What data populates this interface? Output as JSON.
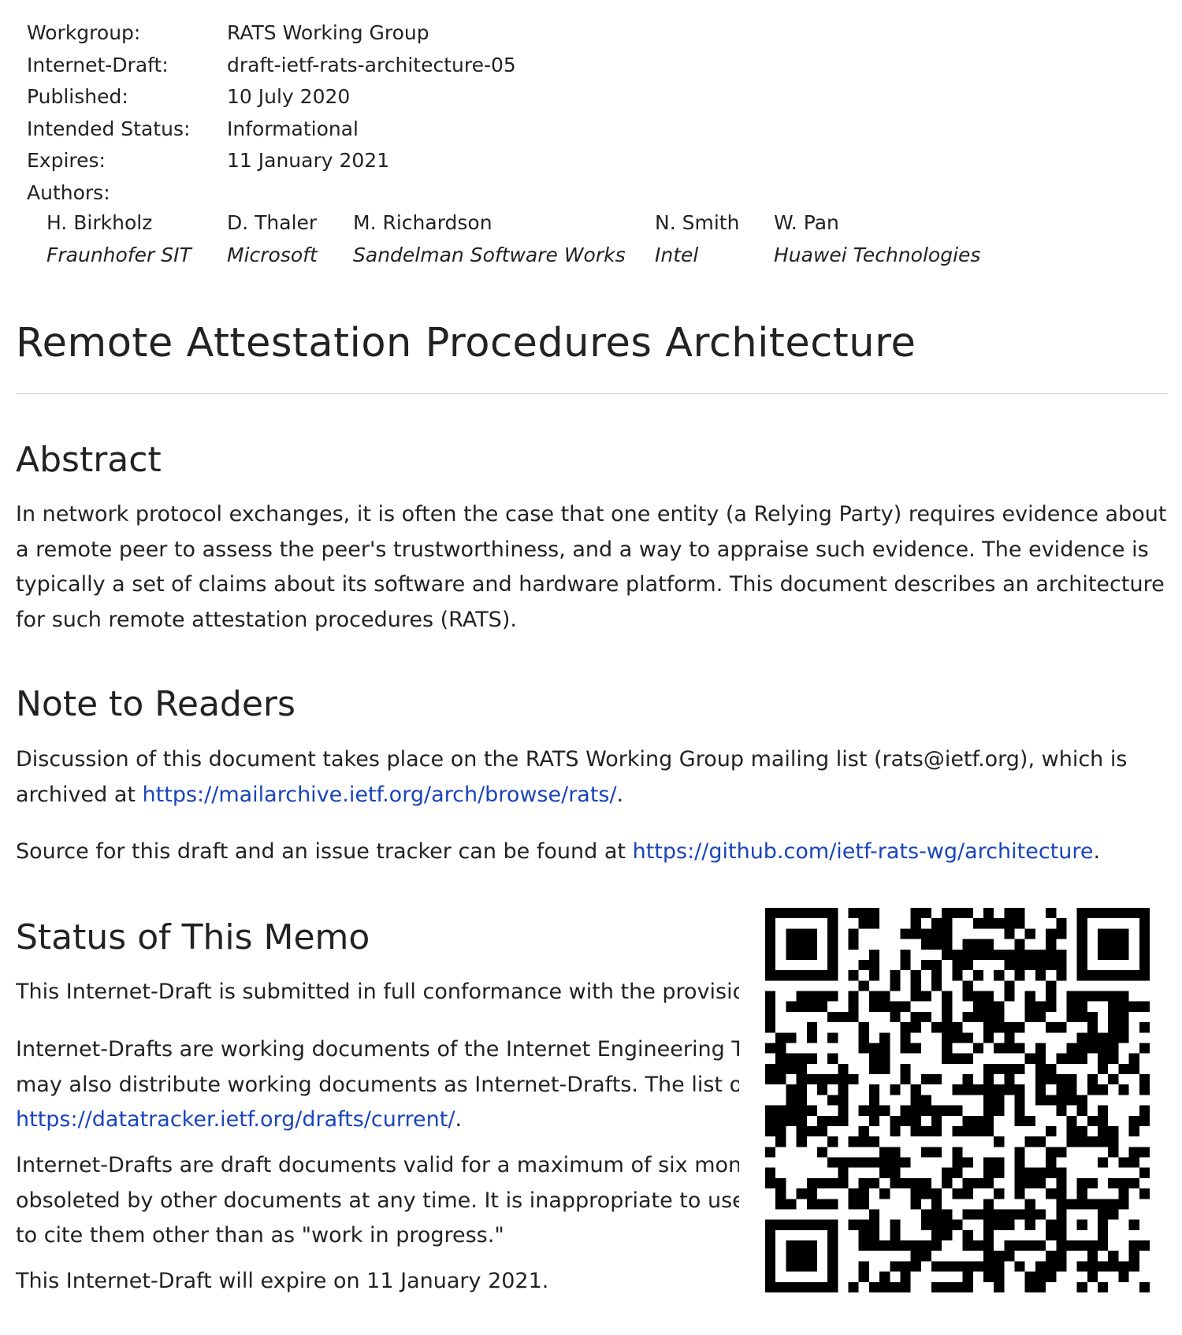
{
  "meta": {
    "rows": [
      {
        "label": "Workgroup:",
        "value": "RATS Working Group"
      },
      {
        "label": "Internet-Draft:",
        "value": "draft-ietf-rats-architecture-05"
      },
      {
        "label": "Published:",
        "value": "10 July 2020"
      },
      {
        "label": "Intended Status:",
        "value": "Informational"
      },
      {
        "label": "Expires:",
        "value": "11 January 2021"
      }
    ],
    "authors_label": "Authors:",
    "authors": [
      {
        "name": "H. Birkholz",
        "org": "Fraunhofer SIT"
      },
      {
        "name": "D. Thaler",
        "org": "Microsoft"
      },
      {
        "name": "M. Richardson",
        "org": "Sandelman Software Works"
      },
      {
        "name": "N. Smith",
        "org": "Intel"
      },
      {
        "name": "W. Pan",
        "org": "Huawei Technologies"
      }
    ]
  },
  "title": "Remote Attestation Procedures Architecture",
  "abstract": {
    "heading": "Abstract",
    "text": "In network protocol exchanges, it is often the case that one entity (a Relying Party) requires evidence about a remote peer to assess the peer's trustworthiness, and a way to appraise such evidence. The evidence is typically a set of claims about its software and hardware platform. This document describes an architecture for such remote attestation procedures (RATS)."
  },
  "readers": {
    "heading": "Note to Readers",
    "p1_text": "Discussion of this document takes place on the RATS Working Group mailing list (rats@ietf.org), which is archived at ",
    "p1_link": "https://mailarchive.ietf.org/arch/browse/rats/",
    "p1_end": ".",
    "p2_text": "Source for this draft and an issue tracker can be found at ",
    "p2_link": "https://github.com/ietf-rats-wg/architecture",
    "p2_end": "."
  },
  "status": {
    "heading": "Status of This Memo",
    "p1": "This Internet-Draft is submitted in full conformance with the provisior",
    "p2_line1": "Internet-Drafts are working documents of the Internet Engineering Ta",
    "p2_line2": "may also distribute working documents as Internet-Drafts. The list of",
    "p2_link": "https://datatracker.ietf.org/drafts/current/",
    "p2_end": ".",
    "p3_line1": "Internet-Drafts are draft documents valid for a maximum of six montl",
    "p3_line2": "obsoleted by other documents at any time. It is inappropriate to use I",
    "p3_line3": "to cite them other than as \"work in progress.\"",
    "p4": "This Internet-Draft will expire on 11 January 2021."
  },
  "qr_code": {
    "icon": "qr-code"
  }
}
